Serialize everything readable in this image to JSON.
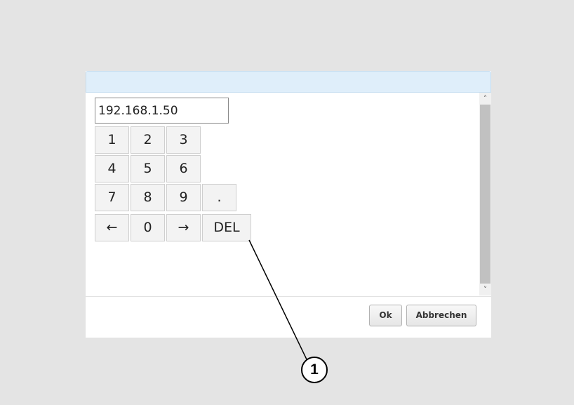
{
  "dialog": {
    "title": "",
    "ip_value": "192.168.1.50"
  },
  "keypad": {
    "rows": [
      [
        "1",
        "2",
        "3"
      ],
      [
        "4",
        "5",
        "6"
      ],
      [
        "7",
        "8",
        "9",
        "."
      ],
      [
        "←",
        "0",
        "→",
        "DEL"
      ]
    ]
  },
  "scrollbar": {
    "up_icon": "chevron-up-icon",
    "up_glyph": "˄",
    "down_icon": "chevron-down-icon",
    "down_glyph": "˅"
  },
  "buttons": {
    "ok_label": "Ok",
    "cancel_label": "Abbrechen"
  },
  "callout": {
    "number": "1",
    "target": "DEL"
  },
  "colors": {
    "background": "#e4e4e4",
    "titlebar": "#dfeefa",
    "key_face": "#f3f3f3",
    "scroll_thumb": "#c1c1c1"
  }
}
